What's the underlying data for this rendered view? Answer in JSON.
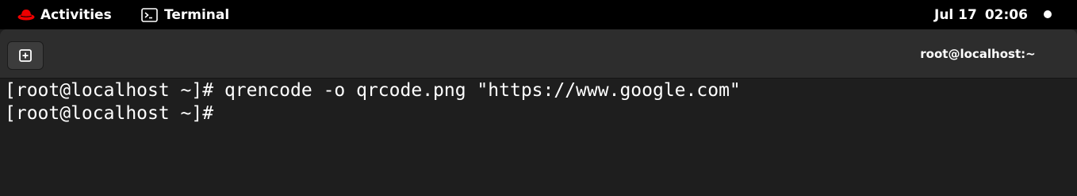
{
  "topbar": {
    "activities_label": "Activities",
    "app_name": "Terminal",
    "clock": {
      "date": "Jul 17",
      "time": "02:06"
    },
    "icons": {
      "logo": "redhat-icon",
      "app": "terminal-app-icon",
      "status": "status-dot"
    }
  },
  "window": {
    "title": "root@localhost:~",
    "new_tab_icon": "new-tab-icon"
  },
  "terminal": {
    "lines": [
      "[root@localhost ~]# qrencode -o qrcode.png \"https://www.google.com\"",
      "[root@localhost ~]#"
    ]
  },
  "colors": {
    "topbar_bg": "#000000",
    "headerbar_bg": "#2d2d2d",
    "terminal_bg": "#1e1e1e",
    "text": "#ffffff",
    "logo_red": "#ee0000"
  }
}
